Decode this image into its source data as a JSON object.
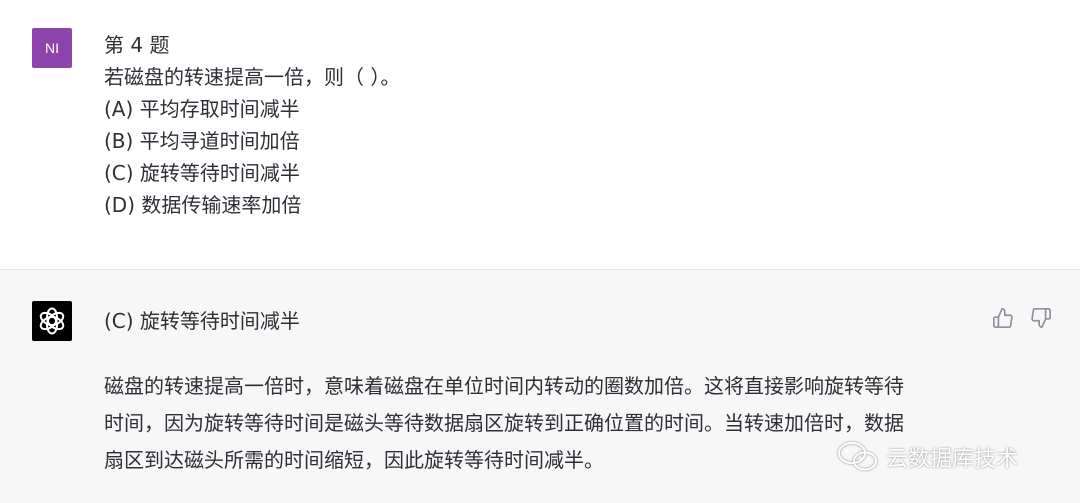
{
  "user_message": {
    "avatar_initials": "NI",
    "avatar_color": "#8e44ad",
    "lines": [
      "第 4 题",
      "若磁盘的转速提高一倍，则（ ）。",
      "(A) 平均存取时间减半",
      "(B) 平均寻道时间加倍",
      "(C) 旋转等待时间减半",
      "(D) 数据传输速率加倍"
    ]
  },
  "assistant_message": {
    "avatar_icon": "openai-logo-icon",
    "answer_line": "(C) 旋转等待时间减半",
    "explanation_lines": [
      "磁盘的转速提高一倍时，意味着磁盘在单位时间内转动的圈数加倍。这将直接影响旋转等待",
      "时间，因为旋转等待时间是磁头等待数据扇区旋转到正确位置的时间。当转速加倍时，数据",
      "扇区到达磁头所需的时间缩短，因此旋转等待时间减半。"
    ],
    "feedback": {
      "thumbs_up_icon": "thumbs-up-icon",
      "thumbs_down_icon": "thumbs-down-icon"
    }
  },
  "watermark": {
    "text": "云数据库技术",
    "icon": "wechat-icon"
  }
}
